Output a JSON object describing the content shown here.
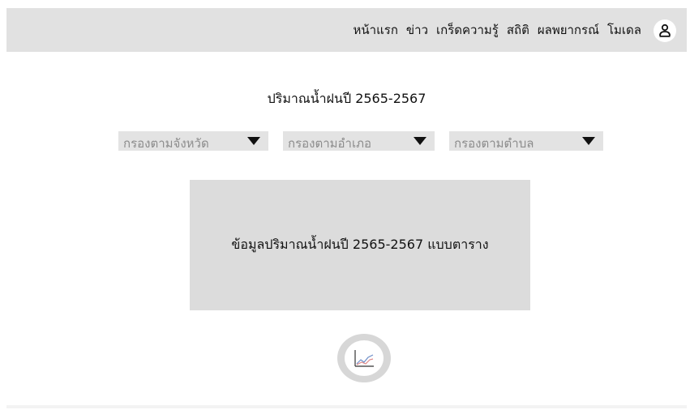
{
  "nav": {
    "items": [
      {
        "label": "หน้าแรก"
      },
      {
        "label": "ข่าว"
      },
      {
        "label": "เกร็ดความรู้"
      },
      {
        "label": "สถิติ"
      },
      {
        "label": "ผลพยากรณ์"
      },
      {
        "label": "โมเดล"
      }
    ],
    "user_icon": "user-icon"
  },
  "main": {
    "title": "ปริมาณน้ำฝนปี 2565-2567",
    "filters": {
      "province": "กรองตามจังหวัด",
      "district": "กรองตามอำเภอ",
      "subdistrict": "กรองตามตำบล"
    },
    "table_placeholder": "ข้อมูลปริมาณน้ำฝนปี 2565-2567 แบบตาราง",
    "chart_icon": "line-chart-icon"
  },
  "colors": {
    "nav_bg": "#e1e1e1",
    "placeholder_bg": "#dcdcdc",
    "chart_line_1": "#6f8fc8",
    "chart_line_2": "#e08a8a"
  }
}
